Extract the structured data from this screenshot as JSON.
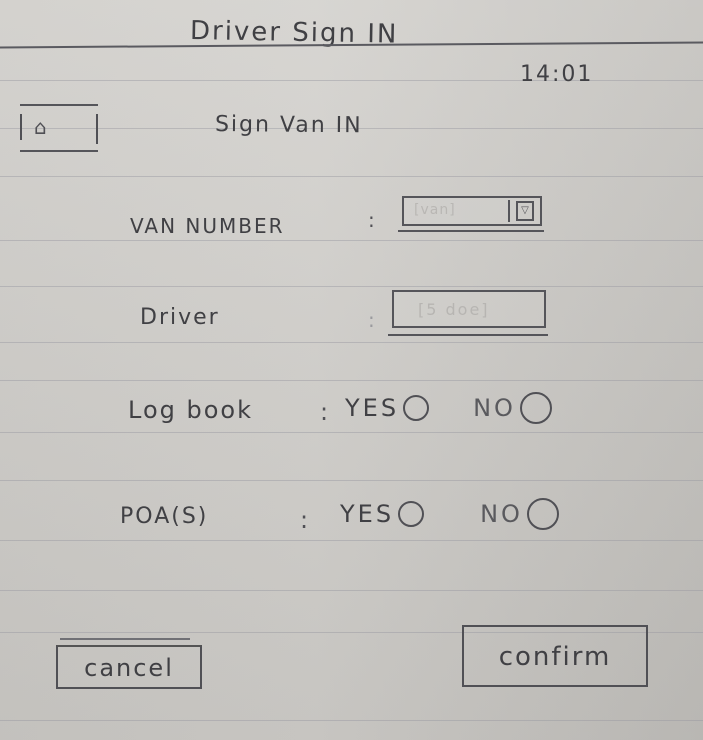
{
  "header": {
    "title": "Driver Sign IN",
    "clock": "14:01"
  },
  "screen": {
    "title": "Sign Van IN",
    "home_icon": "home-icon"
  },
  "form": {
    "van_number": {
      "label": "VAN NUMBER",
      "colon": ":",
      "placeholder": "[van]",
      "dropdown_icon": "chevron-down-icon"
    },
    "driver": {
      "label": "Driver",
      "colon": ":",
      "placeholder": "[5 doe]"
    },
    "log_book": {
      "label": "Log book",
      "colon": ":",
      "yes_label": "YES",
      "no_label": "NO"
    },
    "poa": {
      "label": "POA(S)",
      "colon": ":",
      "yes_label": "YES",
      "no_label": "NO"
    }
  },
  "actions": {
    "cancel_label": "cancel",
    "confirm_label": "confirm"
  },
  "colors": {
    "paper": "#cfcdc9",
    "ink": "#404044",
    "rule": "#96969f"
  }
}
